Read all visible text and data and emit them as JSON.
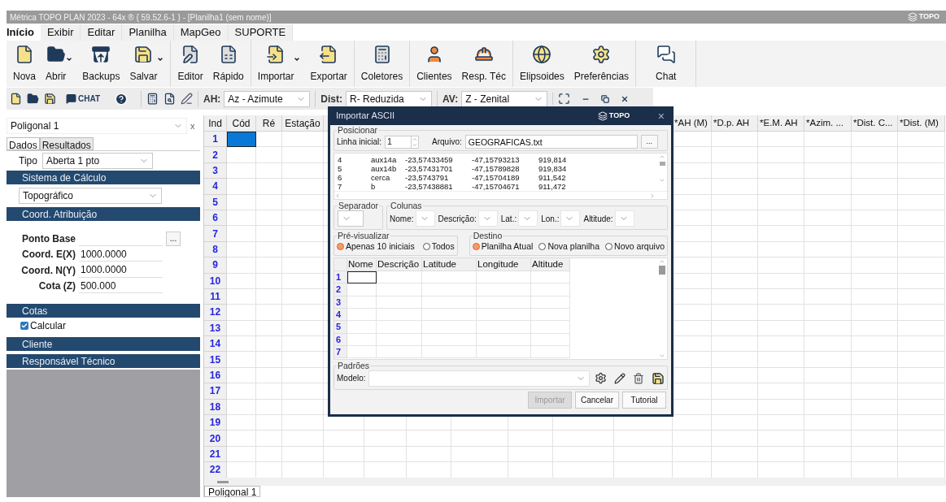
{
  "title_bar": {
    "title": "Métrica TOPO PLAN 2023 - 64x ® { 59.52.6-1 } - [Planilha1 (sem nome)]",
    "logo": "TOPO"
  },
  "menu_tabs": [
    {
      "label": "Início",
      "selected": true
    },
    {
      "label": "Exibir",
      "selected": false
    },
    {
      "label": "Editar",
      "selected": false
    },
    {
      "label": "Planilha",
      "selected": false
    },
    {
      "label": "MapGeo",
      "selected": false
    },
    {
      "label": "SUPORTE",
      "selected": false
    }
  ],
  "ribbon_groups": [
    [
      {
        "label": "Nova",
        "dropdown": false
      },
      {
        "label": "Abrir",
        "dropdown": true
      },
      {
        "label": "Backups",
        "dropdown": false
      },
      {
        "label": "Salvar",
        "dropdown": true
      }
    ],
    [
      {
        "label": "Editor",
        "dropdown": false
      },
      {
        "label": "Rápido",
        "dropdown": false
      }
    ],
    [
      {
        "label": "Importar",
        "dropdown": true
      },
      {
        "label": "Exportar",
        "dropdown": false
      }
    ],
    [
      {
        "label": "Coletores",
        "dropdown": false
      }
    ],
    [
      {
        "label": "Clientes",
        "dropdown": false
      },
      {
        "label": "Resp. Téc",
        "dropdown": false
      }
    ],
    [
      {
        "label": "Elipsoides",
        "dropdown": false
      },
      {
        "label": "Preferências",
        "dropdown": false
      }
    ],
    [
      {
        "label": "Chat",
        "dropdown": false
      }
    ]
  ],
  "toolbar": {
    "chat": "CHAT",
    "dropdowns": [
      {
        "label": "AH:",
        "value": "Az - Azimute"
      },
      {
        "label": "Dist:",
        "value": "R- Reduzida"
      },
      {
        "label": "AV:",
        "value": "Z - Zenital"
      }
    ]
  },
  "panel": {
    "selector": "Poligonal 1",
    "close": "x",
    "tabs": [
      {
        "label": "Dados",
        "selected": true
      },
      {
        "label": "Resultados",
        "selected": false
      }
    ],
    "tipo": {
      "label": "Tipo",
      "value": "Aberta 1 pto"
    },
    "sistema": {
      "header": "Sistema de Cálculo",
      "value": "Topográfico"
    },
    "coord": {
      "header": "Coord. Atribuição",
      "fields": [
        {
          "label": "Ponto Base",
          "browse": "..."
        },
        {
          "label": "Coord. E(X)",
          "value": "1000.0000"
        },
        {
          "label": "Coord. N(Y)",
          "value": "1000.0000"
        },
        {
          "label": "Cota (Z)",
          "value": "500.000"
        }
      ]
    },
    "cotas": {
      "header": "Cotas",
      "checkbox": {
        "label": "Calcular",
        "checked": true
      }
    },
    "collapsed": [
      "Cliente",
      "Responsável Técnico"
    ]
  },
  "grid": {
    "left_columns": [
      "Ind",
      "Cód",
      "Ré",
      "Estação"
    ],
    "right_columns": [
      "*AH (M)",
      "*D.p. AH",
      "*E.M. AH",
      "*Azim. ...",
      "*Dist. C...",
      "*Dist. (M)"
    ],
    "rows": [
      {
        "index": "1",
        "selected": true
      },
      {
        "index": "2",
        "selected": false
      },
      {
        "index": "3",
        "selected": false
      },
      {
        "index": "4",
        "selected": false
      },
      {
        "index": "5",
        "selected": false
      },
      {
        "index": "6",
        "selected": false
      },
      {
        "index": "7",
        "selected": false
      },
      {
        "index": "8",
        "selected": false
      },
      {
        "index": "9",
        "selected": false
      },
      {
        "index": "10",
        "selected": false
      },
      {
        "index": "11",
        "selected": false
      },
      {
        "index": "12",
        "selected": false
      },
      {
        "index": "13",
        "selected": false
      },
      {
        "index": "14",
        "selected": false
      },
      {
        "index": "15",
        "selected": false
      },
      {
        "index": "16",
        "selected": false
      },
      {
        "index": "17",
        "selected": false
      },
      {
        "index": "18",
        "selected": false
      },
      {
        "index": "19",
        "selected": false
      },
      {
        "index": "20",
        "selected": false
      },
      {
        "index": "21",
        "selected": false
      },
      {
        "index": "22",
        "selected": false
      }
    ]
  },
  "sheet_tabs": [
    {
      "label": "Poligonal 1",
      "selected": true
    }
  ],
  "dialog": {
    "title": "Importar ASCII",
    "logo": "TOPO",
    "close": "×",
    "posicionar": {
      "legend": "Posicionar",
      "start_label": "Linha inicial:",
      "start_value": "1",
      "file_label": "Arquivo:",
      "file_value": "GEOGRAFICAS.txt",
      "browse": "..."
    },
    "preview_lines": [
      [
        "4",
        "aux14a",
        "-23,57433459",
        "-47,15793213",
        "919,814"
      ],
      [
        "5",
        "aux14b",
        "-23,57431701",
        "-47,15789828",
        "919,834"
      ],
      [
        "6",
        "cerca",
        "-23,5743791",
        "-47,15704189",
        "911,542"
      ],
      [
        "7",
        "b",
        "-23,57438881",
        "-47,15704671",
        "911,472"
      ]
    ],
    "separador": {
      "legend": "Separador"
    },
    "colunas": {
      "legend": "Colunas",
      "fields": [
        "Nome:",
        "Descrição:",
        "Lat.:",
        "Lon.:",
        "Altitude:"
      ]
    },
    "previsualizar": {
      "legend": "Pré-visualizar",
      "options": [
        {
          "label": "Apenas 10 iniciais",
          "selected": true
        },
        {
          "label": "Todos",
          "selected": false
        }
      ]
    },
    "destino": {
      "legend": "Destino",
      "options": [
        {
          "label": "Planilha Atual",
          "selected": true
        },
        {
          "label": "Nova planilha",
          "selected": false
        },
        {
          "label": "Novo arquivo",
          "selected": false
        }
      ]
    },
    "table": {
      "columns": [
        "Nome",
        "Descrição",
        "Latitude",
        "Longitude",
        "Altitude"
      ],
      "rows": [
        "1",
        "2",
        "3",
        "4",
        "5",
        "6",
        "7"
      ]
    },
    "padroes": {
      "legend": "Padrões",
      "model_label": "Modelo:"
    },
    "buttons": [
      {
        "label": "Importar",
        "disabled": true
      },
      {
        "label": "Cancelar",
        "disabled": false
      },
      {
        "label": "Tutorial",
        "disabled": false
      }
    ]
  }
}
